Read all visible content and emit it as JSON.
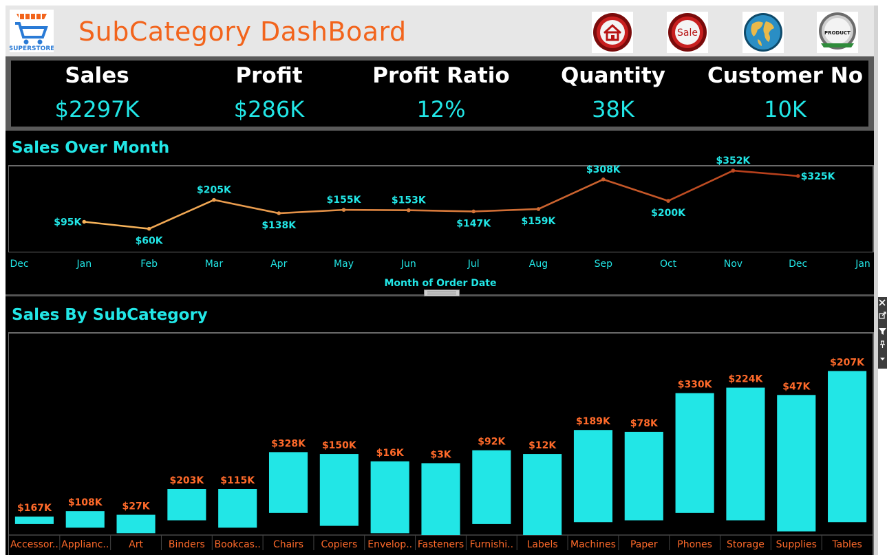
{
  "header": {
    "title": "SubCategory DashBoard",
    "logo_text": "SUPERSTORE",
    "nav": [
      {
        "name": "home-icon"
      },
      {
        "name": "sale-icon",
        "label": "Sale"
      },
      {
        "name": "globe-icon"
      },
      {
        "name": "product-badge-icon",
        "label": "PRODUCT"
      }
    ]
  },
  "kpis": [
    {
      "label": "Sales",
      "value": "$2297K"
    },
    {
      "label": "Profit",
      "value": "$286K"
    },
    {
      "label": "Profit Ratio",
      "value": "12%"
    },
    {
      "label": "Quantity",
      "value": "38K"
    },
    {
      "label": "Customer No",
      "value": "10K"
    }
  ],
  "colors": {
    "accent": "#22e6e6",
    "title_orange": "#f2641c",
    "bar_label": "#ff6a2a",
    "line_start": "#f7b35a",
    "line_end": "#b8401c",
    "background": "#000000"
  },
  "chart_data": [
    {
      "type": "line",
      "title": "Sales Over Month",
      "xlabel": "Month of Order Date",
      "x_ticks": [
        "Dec",
        "Jan",
        "Feb",
        "Mar",
        "Apr",
        "May",
        "Jun",
        "Jul",
        "Aug",
        "Sep",
        "Oct",
        "Nov",
        "Dec",
        "Jan"
      ],
      "categories": [
        "Jan",
        "Feb",
        "Mar",
        "Apr",
        "May",
        "Jun",
        "Jul",
        "Aug",
        "Sep",
        "Oct",
        "Nov",
        "Dec"
      ],
      "values": [
        95,
        60,
        205,
        138,
        155,
        153,
        147,
        159,
        308,
        200,
        352,
        325
      ],
      "labels": [
        "$95K",
        "$60K",
        "$205K",
        "$138K",
        "$155K",
        "$153K",
        "$147K",
        "$159K",
        "$308K",
        "$200K",
        "$352K",
        "$325K"
      ],
      "label_pos": [
        "left",
        "below",
        "above",
        "below",
        "above",
        "above",
        "below",
        "below",
        "above",
        "below",
        "above",
        "right"
      ],
      "ylim": [
        0,
        380
      ],
      "grid": false
    },
    {
      "type": "bar",
      "subtype": "gantt",
      "title": "Sales By SubCategory",
      "categories": [
        "Accessor..",
        "Applianc..",
        "Art",
        "Binders",
        "Bookcas..",
        "Chairs",
        "Copiers",
        "Envelop..",
        "Fasteners",
        "Furnishi..",
        "Labels",
        "Machines",
        "Paper",
        "Phones",
        "Storage",
        "Supplies",
        "Tables"
      ],
      "bar_top": [
        10,
        13,
        11,
        25,
        25,
        45,
        44,
        40,
        39,
        46,
        44,
        57,
        56,
        77,
        80,
        76,
        89
      ],
      "bar_bottom": [
        6,
        4,
        1,
        8,
        4,
        12,
        5,
        1,
        0,
        6,
        0,
        7,
        8,
        12,
        8,
        2,
        7
      ],
      "labels": [
        "$167K",
        "$108K",
        "$27K",
        "$203K",
        "$115K",
        "$328K",
        "$150K",
        "$16K",
        "$3K",
        "$92K",
        "$12K",
        "$189K",
        "$78K",
        "$330K",
        "$224K",
        "$47K",
        "$207K"
      ],
      "ylim": [
        0,
        100
      ],
      "grid": false
    }
  ]
}
